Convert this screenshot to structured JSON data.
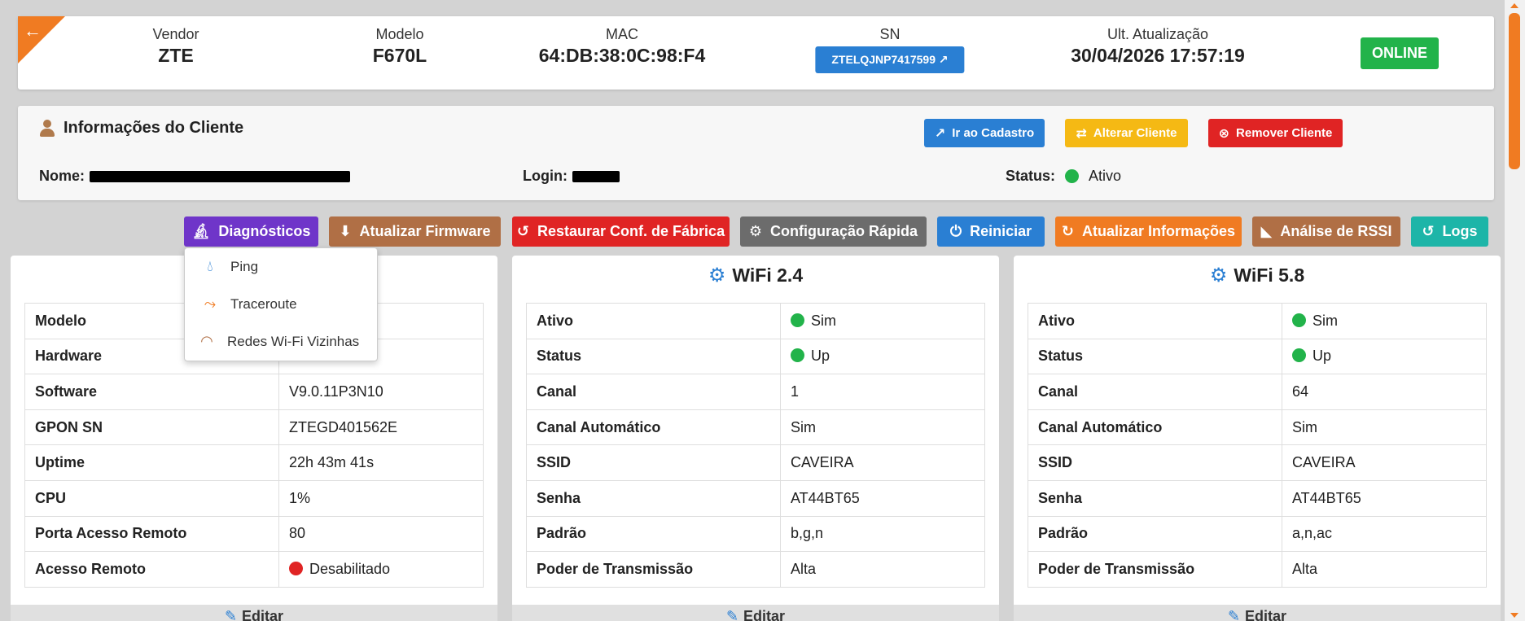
{
  "device": {
    "back_icon": "arrow-left-icon",
    "vendor_label": "Vendor",
    "vendor": "ZTE",
    "model_label": "Modelo",
    "model": "F670L",
    "mac_label": "MAC",
    "mac": "64:DB:38:0C:98:F4",
    "sn_label": "SN",
    "sn": "ZTELQJNP7417599",
    "updated_label": "Ult. Atualização",
    "updated": "30/04/2026 17:57:19",
    "status": "ONLINE"
  },
  "client": {
    "title": "Informações do Cliente",
    "go_to_register": "Ir ao Cadastro",
    "change_client": "Alterar Cliente",
    "remove_client": "Remover Cliente",
    "name_label": "Nome:",
    "login_label": "Login:",
    "status_label": "Status:",
    "status": "Ativo"
  },
  "actions": {
    "diagnostics": "Diagnósticos",
    "update_firmware": "Atualizar Firmware",
    "factory_reset": "Restaurar Conf. de Fábrica",
    "quick_config": "Configuração Rápida",
    "reboot": "Reiniciar",
    "refresh_info": "Atualizar Informações",
    "rssi": "Análise de RSSI",
    "logs": "Logs"
  },
  "diagnostics_menu": {
    "ping": "Ping",
    "traceroute": "Traceroute",
    "wifi_neighbors": "Redes Wi-Fi Vizinhas"
  },
  "device_panel": {
    "rows": [
      {
        "key": "Modelo",
        "value": ""
      },
      {
        "key": "Hardware",
        "value": ""
      },
      {
        "key": "Software",
        "value": "V9.0.11P3N10"
      },
      {
        "key": "GPON SN",
        "value": "ZTEGD401562E"
      },
      {
        "key": "Uptime",
        "value": "22h 43m 41s"
      },
      {
        "key": "CPU",
        "value": "1%"
      },
      {
        "key": "Porta Acesso Remoto",
        "value": "80"
      },
      {
        "key": "Acesso Remoto",
        "value": "Desabilitado"
      }
    ],
    "edit": "Editar"
  },
  "wifi24": {
    "title": "WiFi 2.4",
    "rows": [
      {
        "key": "Ativo",
        "value": "Sim"
      },
      {
        "key": "Status",
        "value": "Up"
      },
      {
        "key": "Canal",
        "value": "1"
      },
      {
        "key": "Canal Automático",
        "value": "Sim"
      },
      {
        "key": "SSID",
        "value": "CAVEIRA"
      },
      {
        "key": "Senha",
        "value": "AT44BT65"
      },
      {
        "key": "Padrão",
        "value": "b,g,n"
      },
      {
        "key": "Poder de Transmissão",
        "value": "Alta"
      }
    ],
    "edit": "Editar"
  },
  "wifi58": {
    "title": "WiFi 5.8",
    "rows": [
      {
        "key": "Ativo",
        "value": "Sim"
      },
      {
        "key": "Status",
        "value": "Up"
      },
      {
        "key": "Canal",
        "value": "64"
      },
      {
        "key": "Canal Automático",
        "value": "Sim"
      },
      {
        "key": "SSID",
        "value": "CAVEIRA"
      },
      {
        "key": "Senha",
        "value": "AT44BT65"
      },
      {
        "key": "Padrão",
        "value": "a,n,ac"
      },
      {
        "key": "Poder de Transmissão",
        "value": "Alta"
      }
    ],
    "edit": "Editar"
  },
  "colors": {
    "orange": "#f07b22",
    "blue": "#2a7fd3",
    "green": "#22b34a",
    "red": "#e02424",
    "purple": "#6f35c9",
    "brown": "#b06f45",
    "gray": "#6c6c6c",
    "teal": "#1db5a8",
    "yellow": "#f5b914"
  }
}
